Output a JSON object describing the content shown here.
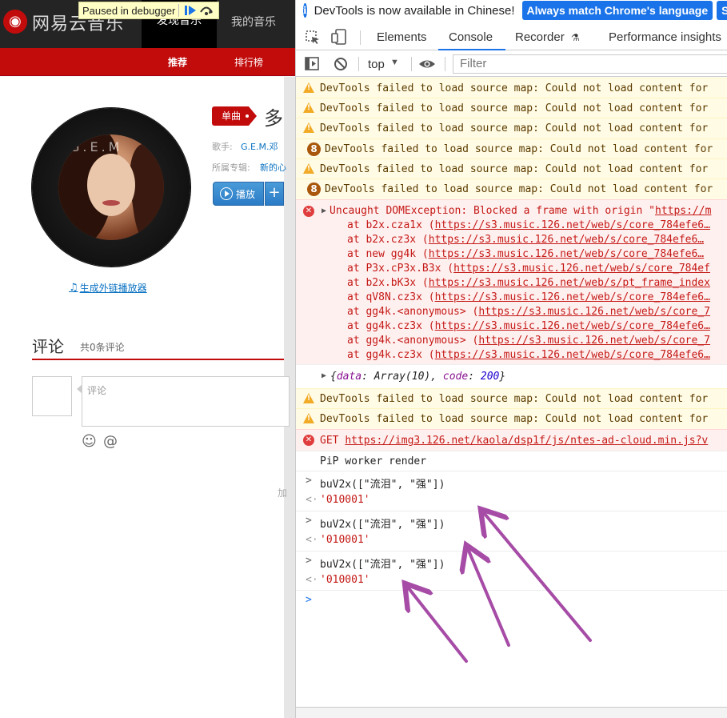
{
  "music_page": {
    "logo_text": "网易云音乐",
    "nav": {
      "discover": "发现音乐",
      "mine": "我的音乐"
    },
    "debug_pill": {
      "label": "Paused in debugger"
    },
    "subnav": {
      "recommend": "推荐",
      "rank": "排行榜"
    },
    "song": {
      "tag": "单曲",
      "title": "多",
      "artist_label": "歌手:",
      "artist": "G.E.M.邓",
      "album_label": "所属专辑:",
      "album": "新的心",
      "play_label": "播放",
      "add_label": "+"
    },
    "cover_text": "G.E.M",
    "ext_player": "生成外链播放器",
    "comments": {
      "title": "评论",
      "count": "共0条评论",
      "placeholder": "评论",
      "emoji": "☺",
      "at": "@"
    },
    "trailing_char": "加"
  },
  "devtools": {
    "infobar": {
      "message": "DevTools is now available in Chinese!",
      "match_button": "Always match Chrome's language",
      "switch_button": "S"
    },
    "tabs": [
      "Elements",
      "Console",
      "Recorder",
      "Performance insights"
    ],
    "active_tab": "Console",
    "toolbar": {
      "context": "top",
      "filter_placeholder": "Filter"
    },
    "messages": {
      "sourcemap_warn": "DevTools failed to load source map: Could not load content for",
      "group_count": "8",
      "exception": {
        "head": "Uncaught DOMException: Blocked a frame with origin \"",
        "head_link": "https://m",
        "stack": [
          {
            "fn": "at b2x.cza1x (",
            "url": "https://s3.music.126.net/web/s/core_784efe6…"
          },
          {
            "fn": "at b2x.cz3x (",
            "url": "https://s3.music.126.net/web/s/core_784efe6…"
          },
          {
            "fn": "at new gg4k (",
            "url": "https://s3.music.126.net/web/s/core_784efe6…"
          },
          {
            "fn": "at P3x.cP3x.B3x (",
            "url": "https://s3.music.126.net/web/s/core_784ef"
          },
          {
            "fn": "at b2x.bK3x (",
            "url": "https://s3.music.126.net/web/s/pt_frame_index"
          },
          {
            "fn": "at qV8N.cz3x (",
            "url": "https://s3.music.126.net/web/s/core_784efe6…"
          },
          {
            "fn": "at gg4k.<anonymous> (",
            "url": "https://s3.music.126.net/web/s/core_7"
          },
          {
            "fn": "at gg4k.cz3x (",
            "url": "https://s3.music.126.net/web/s/core_784efe6…"
          },
          {
            "fn": "at gg4k.<anonymous> (",
            "url": "https://s3.music.126.net/web/s/core_7"
          },
          {
            "fn": "at gg4k.cz3x (",
            "url": "https://s3.music.126.net/web/s/core_784efe6…"
          }
        ]
      },
      "object_log": {
        "open": "{",
        "data_key": "data",
        "data_val": "Array(10)",
        "code_key": "code",
        "code_val": "200",
        "close": "}"
      },
      "get_error": {
        "method": "GET",
        "url": "https://img3.126.net/kaola/dsp1f/js/ntes-ad-cloud.min.js?v"
      },
      "pip_log": "PiP worker render",
      "commands": [
        {
          "input": "buV2x([\"流泪\", \"强\"])",
          "output": "'010001'"
        },
        {
          "input": "buV2x([\"流泪\", \"强\"])",
          "output": "'010001'"
        },
        {
          "input": "buV2x([\"流泪\", \"强\"])",
          "output": "'010001'"
        }
      ]
    },
    "drawer_text": ""
  },
  "colors": {
    "netease_red": "#c20c0c",
    "chrome_blue": "#1a73e8",
    "warning_bg": "#fffbe5",
    "error_bg": "#fff0f0",
    "annotation_arrow": "#a64ca6"
  }
}
